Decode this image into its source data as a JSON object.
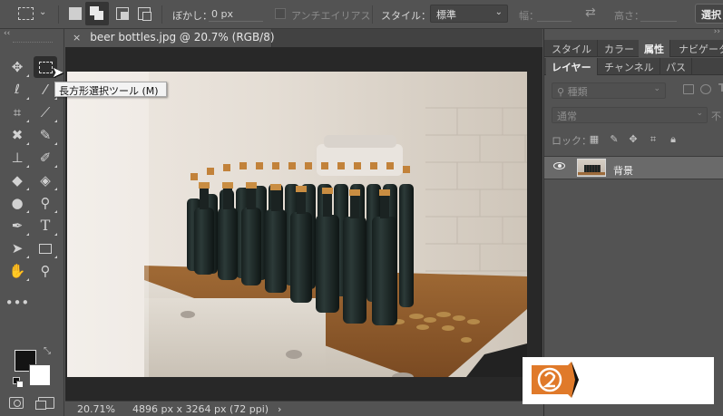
{
  "options_bar": {
    "feather_label": "ぼかし：",
    "feather_value": "0 px",
    "antialias_label": "アンチエイリアス",
    "style_label": "スタイル：",
    "style_value": "標準",
    "width_label": "幅：",
    "height_label": "高さ：",
    "select_button": "選択"
  },
  "tooltip": {
    "text": "長方形選択ツール (M)"
  },
  "document": {
    "tab_title": "beer bottles.jpg @ 20.7% (RGB/8)",
    "close_symbol": "×"
  },
  "status_bar": {
    "zoom": "20.71%",
    "dimensions": "4896 px x 3264 px (72 ppi)",
    "arrow": "›"
  },
  "panels": {
    "top_tabs": [
      "スタイル",
      "カラー",
      "属性",
      "ナビゲータ"
    ],
    "active_top_tab": "属性",
    "layer_tabs": [
      "レイヤー",
      "チャンネル",
      "パス"
    ],
    "active_layer_tab": "レイヤー",
    "kind_filter": "種類",
    "blend_mode": "通常",
    "opacity_label": "不",
    "lock_label": "ロック：",
    "layer_name": "背景"
  },
  "colors": {
    "foreground": "#141414",
    "background": "#ffffff",
    "ui_panel": "#535353",
    "watermark_orange": "#e07a2a"
  }
}
